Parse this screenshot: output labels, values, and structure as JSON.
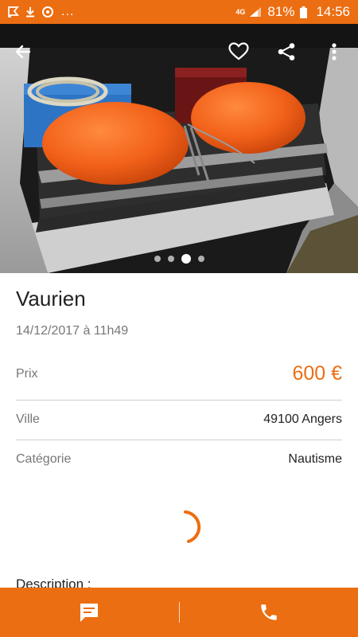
{
  "status_bar": {
    "network": "4G",
    "battery": "81%",
    "time": "14:56",
    "more": "...",
    "icons": [
      "notification-flag-icon",
      "download-icon",
      "sync-icon",
      "signal-icon",
      "battery-icon"
    ]
  },
  "toolbar": {
    "back_icon": "arrow-left-icon",
    "favorite_icon": "heart-outline-icon",
    "share_icon": "share-icon",
    "menu_icon": "more-vertical-icon"
  },
  "gallery": {
    "image_count": 4,
    "active_index": 2
  },
  "listing": {
    "title": "Vaurien",
    "date": "14/12/2017 à 11h49",
    "price_label": "Prix",
    "price": "600 €",
    "city_label": "Ville",
    "city": "49100 Angers",
    "category_label": "Catégorie",
    "category": "Nautisme",
    "description_label": "Description :"
  },
  "actions": {
    "message_icon": "chat-bubble-icon",
    "call_icon": "phone-icon"
  },
  "colors": {
    "accent": "#ec6e12",
    "separator": "#cfcfcf",
    "muted_text": "#777777"
  }
}
